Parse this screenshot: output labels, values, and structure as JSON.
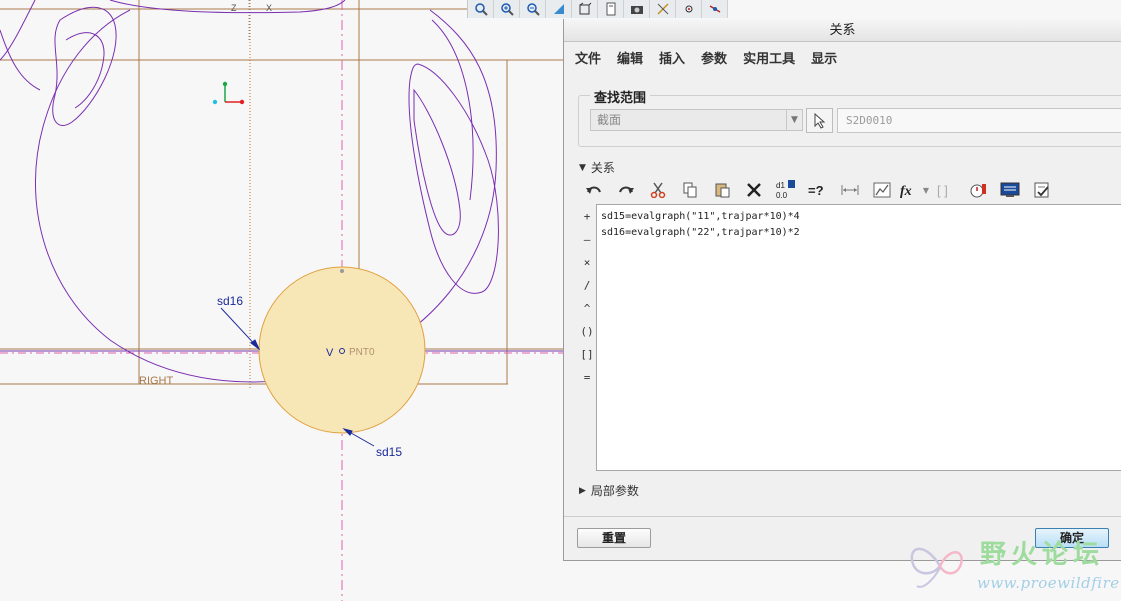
{
  "sketch": {
    "dim_sd16": "sd16",
    "dim_sd15": "sd15",
    "label_right": "RIGHT",
    "label_pnt0": "PNT0",
    "label_v": "V",
    "label_z": "Z",
    "label_x": "X"
  },
  "dialog": {
    "title": "关系",
    "menu": [
      "文件",
      "编辑",
      "插入",
      "参数",
      "实用工具",
      "显示"
    ],
    "scope": {
      "legend": "查找范围",
      "selected": "截面",
      "selection_value": "S2D0010"
    },
    "relations_label": "关系",
    "toolbar_icon_d1": "d1",
    "toolbar_icon_00": "0.0",
    "toolbar_icon_eq": "=?",
    "toolbar_icon_fx": "fx",
    "toolbar_icon_brackets": "[ ]",
    "operators": [
      "+",
      "–",
      "×",
      "/",
      "^",
      "()",
      "[]",
      "="
    ],
    "relations": [
      "sd15=evalgraph(\"11\",trajpar*10)*4",
      "sd16=evalgraph(\"22\",trajpar*10)*2"
    ],
    "local_params_label": "局部参数",
    "reset_label": "重置",
    "ok_label": "确定"
  },
  "watermark": {
    "text": "野火论坛",
    "url": "www.proewildfire.cn"
  },
  "colors": {
    "sketch_purple": "#7a2fb0",
    "sketch_brown": "#a87a4a",
    "dimension_blue": "#1a2a9a",
    "circle_fill": "#f8e7b6",
    "circle_stroke": "#e0a040",
    "centerline": "#e060b0"
  }
}
